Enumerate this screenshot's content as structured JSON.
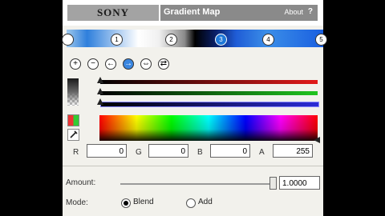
{
  "brand": "SONY",
  "plugin": {
    "title": "Gradient Map",
    "about": "About",
    "help": "?"
  },
  "gradient_nodes": [
    {
      "label": "",
      "selected": false
    },
    {
      "label": "1",
      "selected": false
    },
    {
      "label": "2",
      "selected": false
    },
    {
      "label": "3",
      "selected": true
    },
    {
      "label": "4",
      "selected": false
    },
    {
      "label": "5",
      "selected": false
    }
  ],
  "tools": [
    {
      "name": "add-node-icon",
      "glyph": "+"
    },
    {
      "name": "remove-node-icon",
      "glyph": "−"
    },
    {
      "name": "prev-node-icon",
      "glyph": "←"
    },
    {
      "name": "next-node-icon",
      "glyph": "→"
    },
    {
      "name": "swap-icon",
      "glyph": "⇔"
    },
    {
      "name": "reverse-icon",
      "glyph": "⇄"
    }
  ],
  "color": {
    "labels": {
      "r": "R",
      "g": "G",
      "b": "B",
      "a": "A"
    },
    "r": "0",
    "g": "0",
    "b": "0",
    "a": "255"
  },
  "amount": {
    "label": "Amount:",
    "value": "1.0000",
    "fraction": 1.0
  },
  "mode": {
    "label": "Mode:",
    "options": [
      "Blend",
      "Add"
    ],
    "selected": "Blend"
  },
  "colors": {
    "selected_node": "#1e78d8",
    "panel": "#f2f1ec"
  }
}
